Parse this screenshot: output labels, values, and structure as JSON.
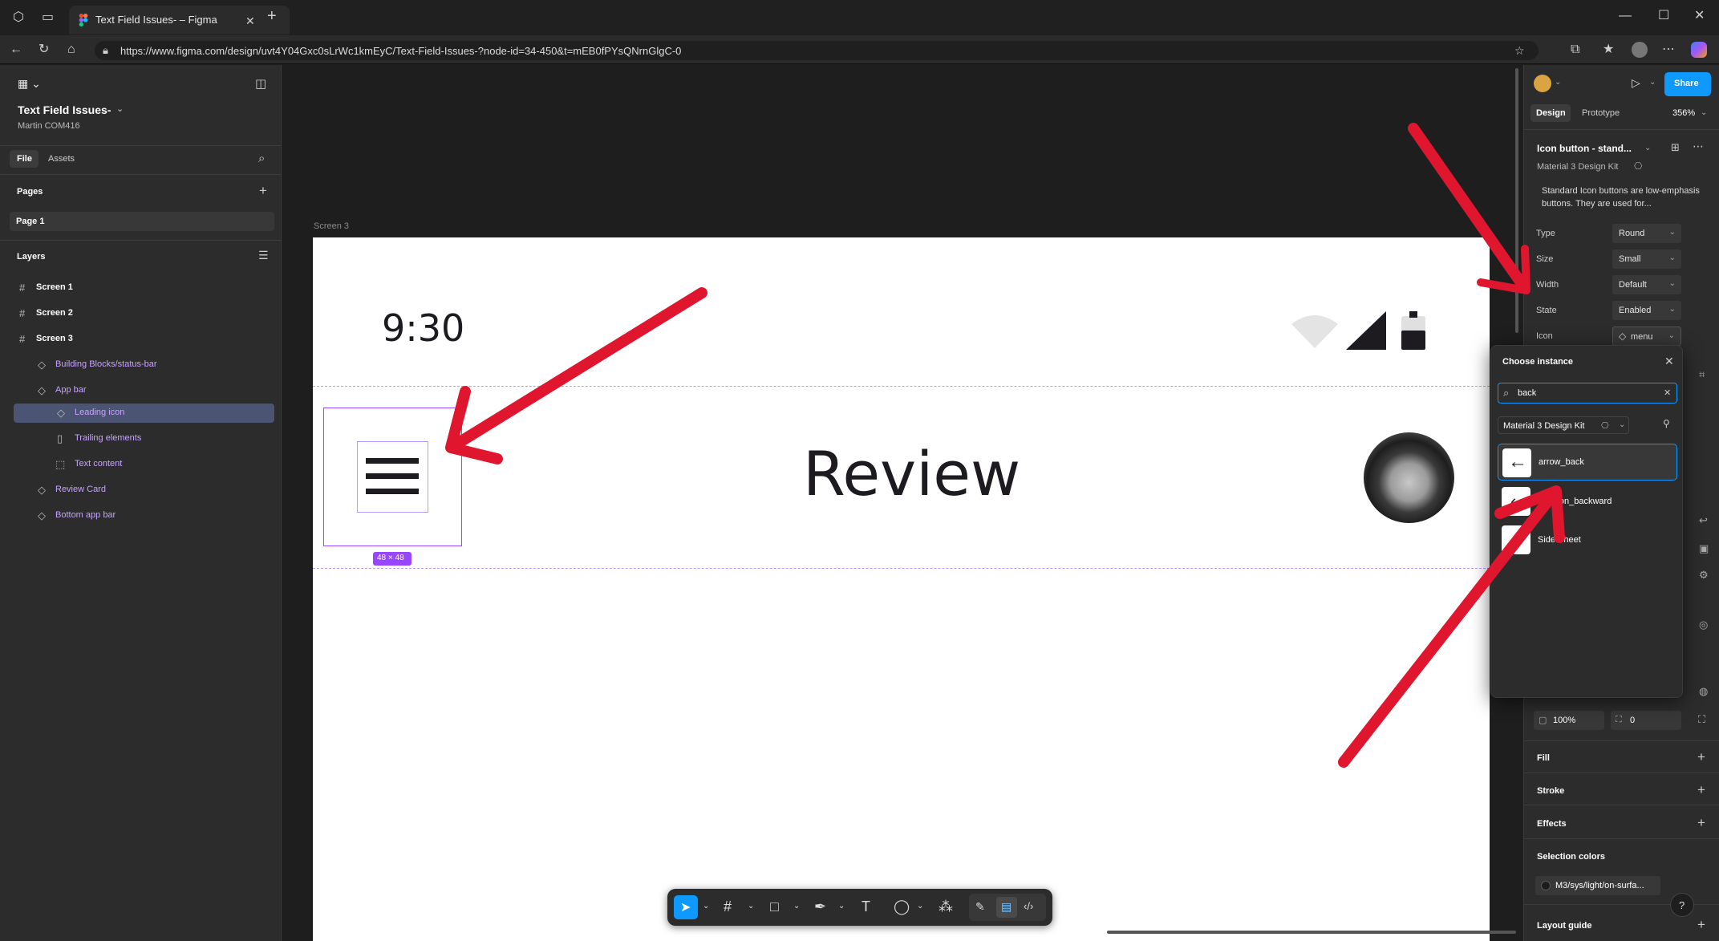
{
  "browser": {
    "tab_title": "Text Field Issues- – Figma",
    "url": "https://www.figma.com/design/uvt4Y04Gxc0sLrWc1kmEyC/Text-Field-Issues-?node-id=34-450&t=mEB0fPYsQNrnGlgC-0"
  },
  "file": {
    "name": "Text Field Issues-",
    "owner": "Martin COM416"
  },
  "left_panel": {
    "tabs": [
      "File",
      "Assets"
    ],
    "pages_label": "Pages",
    "page": "Page 1",
    "layers_label": "Layers",
    "layers": [
      {
        "label": "Screen 1",
        "icon": "frame-icon"
      },
      {
        "label": "Screen 2",
        "icon": "frame-icon"
      },
      {
        "label": "Screen 3",
        "icon": "frame-icon"
      },
      {
        "label": "Building Blocks/status-bar",
        "icon": "instance-icon"
      },
      {
        "label": "App bar",
        "icon": "instance-icon"
      },
      {
        "label": "Leading icon",
        "icon": "instance-icon"
      },
      {
        "label": "Trailing elements",
        "icon": "autolayout-icon"
      },
      {
        "label": "Text content",
        "icon": "frame-dashed-icon"
      },
      {
        "label": "Review Card",
        "icon": "instance-icon"
      },
      {
        "label": "Bottom app bar",
        "icon": "instance-icon"
      }
    ]
  },
  "canvas": {
    "frame_label": "Screen 3",
    "time": "9:30",
    "title": "Review",
    "size_badge": "48 × 48"
  },
  "right_panel": {
    "share": "Share",
    "tabs": [
      "Design",
      "Prototype"
    ],
    "zoom": "356%",
    "component_name": "Icon button - stand...",
    "library": "Material 3 Design Kit",
    "description": "Standard Icon buttons are low-emphasis buttons. They are used for...",
    "props": [
      {
        "label": "Type",
        "value": "Round"
      },
      {
        "label": "Size",
        "value": "Small"
      },
      {
        "label": "Width",
        "value": "Default"
      },
      {
        "label": "State",
        "value": "Enabled"
      },
      {
        "label": "Icon",
        "value": "menu"
      }
    ],
    "opacity": "100%",
    "radius": "0",
    "sections": [
      "Fill",
      "Stroke",
      "Effects"
    ],
    "selection_colors_label": "Selection colors",
    "selection_color": "M3/sys/light/on-surfa...",
    "layout_guide": "Layout guide"
  },
  "popup": {
    "title": "Choose instance",
    "search_value": "back",
    "library": "Material 3 Design Kit",
    "results": [
      "arrow_back",
      "chevron_backward",
      "Side Sheet"
    ]
  },
  "colors": {
    "accent": "#0d99ff",
    "arrow": "#e0162f",
    "selection": "#9747ff"
  }
}
